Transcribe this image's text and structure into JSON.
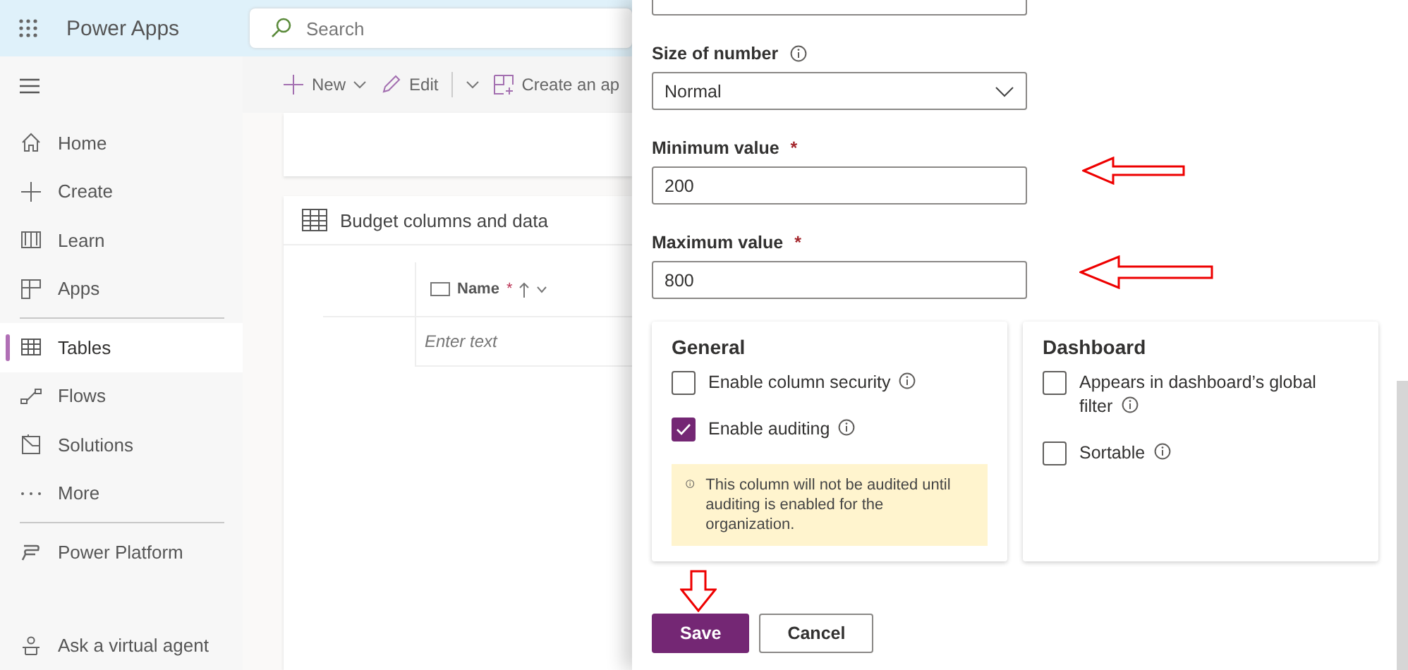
{
  "app": {
    "title": "Power Apps"
  },
  "search": {
    "placeholder": "Search"
  },
  "commands": [
    {
      "label": "New",
      "kind": "dropdown"
    },
    {
      "label": "Edit",
      "kind": "split"
    },
    {
      "label": "Create an ap",
      "kind": "plain"
    }
  ],
  "sidebar": {
    "sections": [
      {
        "items": [
          {
            "label": "Home",
            "selected": false
          },
          {
            "label": "Create",
            "selected": false
          },
          {
            "label": "Learn",
            "selected": false
          },
          {
            "label": "Apps",
            "selected": false
          }
        ]
      },
      {
        "items": [
          {
            "label": "Tables",
            "selected": true
          },
          {
            "label": "Flows",
            "selected": false
          },
          {
            "label": "Solutions",
            "selected": false
          },
          {
            "label": "More",
            "selected": false
          }
        ]
      },
      {
        "items": [
          {
            "label": "Power Platform",
            "selected": false
          }
        ]
      }
    ],
    "footer": {
      "label": "Ask a virtual agent"
    }
  },
  "table_card": {
    "title": "Budget columns and data",
    "columns": [
      {
        "label": "Name",
        "required_mark": "*"
      }
    ],
    "placeholder": "Enter text"
  },
  "panel": {
    "size_field": {
      "label": "Size of number",
      "value": "Normal"
    },
    "fields": [
      {
        "label": "Minimum value",
        "required_mark": "*",
        "value": "200"
      },
      {
        "label": "Maximum value",
        "required_mark": "*",
        "value": "800"
      }
    ],
    "cards": [
      {
        "title": "General",
        "options": [
          {
            "label": "Enable column security",
            "checked": false
          },
          {
            "label": "Enable auditing",
            "checked": true
          }
        ],
        "notice": "This column will not be audited until auditing is enabled for the organization."
      },
      {
        "title": "Dashboard",
        "options": [
          {
            "label": "Appears in dashboard’s global filter",
            "checked": false
          },
          {
            "label": "Sortable",
            "checked": false
          }
        ]
      }
    ],
    "buttons": [
      {
        "label": "Save",
        "kind": "primary"
      },
      {
        "label": "Cancel",
        "kind": "secondary"
      }
    ]
  }
}
